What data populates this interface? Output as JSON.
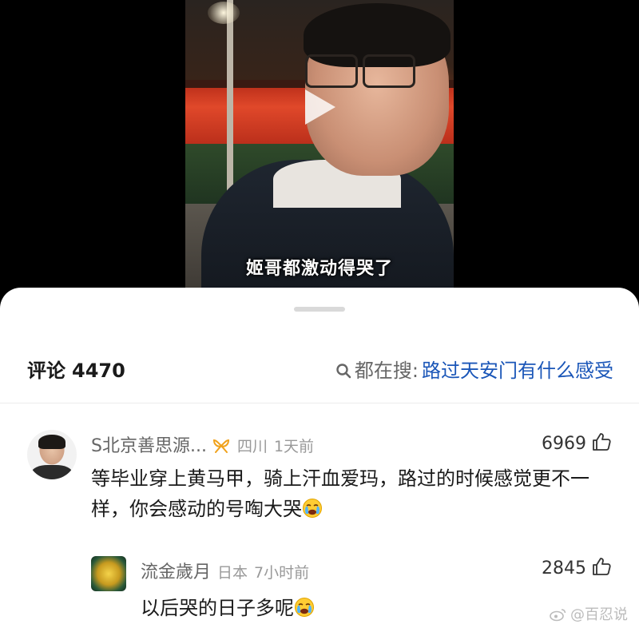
{
  "video": {
    "caption": "姬哥都激动得哭了"
  },
  "comments_header": {
    "label": "评论",
    "count": "4470",
    "search_prefix": "都在搜:",
    "search_topic": "路过天安门有什么感受"
  },
  "comments": [
    {
      "username": "S北京善思源...",
      "location": "四川",
      "time": "1天前",
      "likes": "6969",
      "text": "等毕业穿上黄马甲，骑上汗血爱玛，路过的时候感觉更不一样，你会感动的号啕大哭"
    },
    {
      "username": "流金歲月",
      "location": "日本",
      "time": "7小时前",
      "likes": "2845",
      "text": "以后哭的日子多呢"
    }
  ],
  "watermark": "@百忍说",
  "colors": {
    "topic_link": "#1a56b8",
    "meta_gray": "#999999",
    "sheet_bg": "#ffffff"
  },
  "icons": [
    "play-icon",
    "search-icon",
    "badge-icon",
    "thumbs-up-icon",
    "crying-emoji-icon",
    "weibo-icon"
  ]
}
